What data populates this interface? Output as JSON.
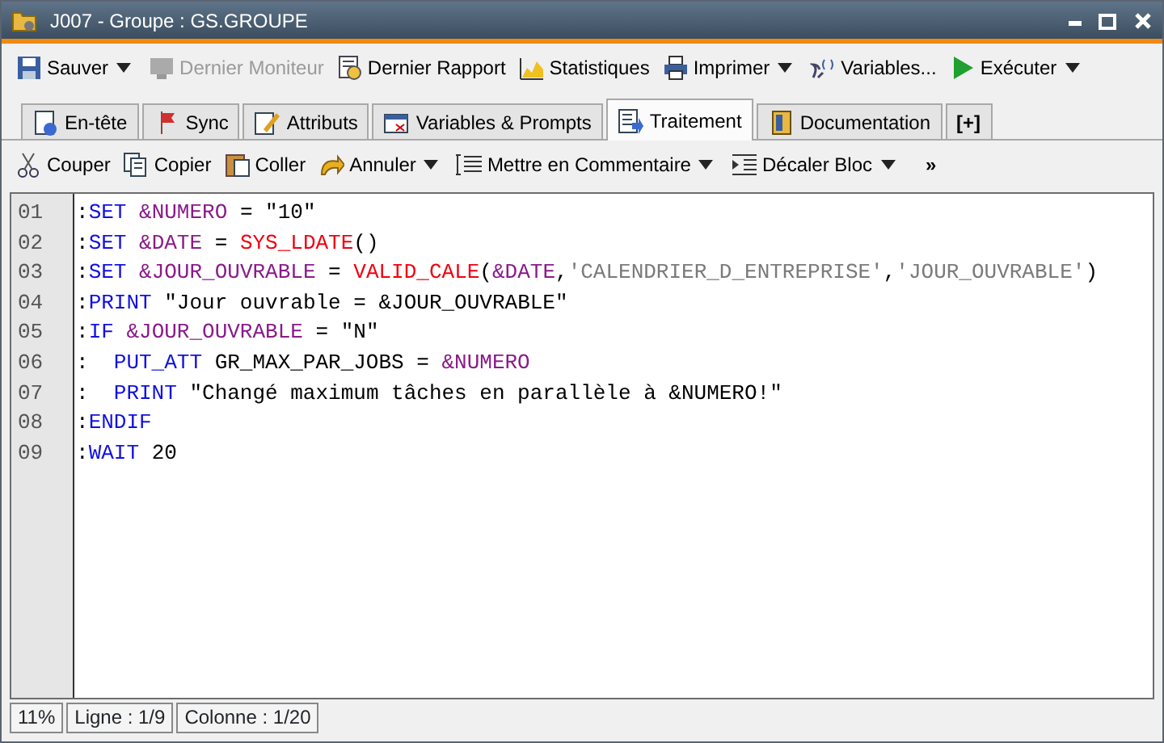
{
  "window": {
    "title": "J007 - Groupe : GS.GROUPE"
  },
  "toolbar": [
    {
      "label": "Sauver",
      "dropdown": true,
      "disabled": false
    },
    {
      "label": "Dernier Moniteur",
      "dropdown": false,
      "disabled": true
    },
    {
      "label": "Dernier Rapport",
      "dropdown": false,
      "disabled": false
    },
    {
      "label": "Statistiques",
      "dropdown": false,
      "disabled": false
    },
    {
      "label": "Imprimer",
      "dropdown": true,
      "disabled": false
    },
    {
      "label": "Variables...",
      "dropdown": false,
      "disabled": false
    },
    {
      "label": "Exécuter",
      "dropdown": true,
      "disabled": false
    }
  ],
  "tabs": [
    {
      "label": "En-tête",
      "selected": false
    },
    {
      "label": "Sync",
      "selected": false
    },
    {
      "label": "Attributs",
      "selected": false
    },
    {
      "label": "Variables & Prompts",
      "selected": false
    },
    {
      "label": "Traitement",
      "selected": true
    },
    {
      "label": "Documentation",
      "selected": false
    },
    {
      "label": "[+]",
      "selected": false
    }
  ],
  "edit_toolbar": [
    {
      "label": "Couper",
      "dropdown": false
    },
    {
      "label": "Copier",
      "dropdown": false
    },
    {
      "label": "Coller",
      "dropdown": false
    },
    {
      "label": "Annuler",
      "dropdown": true
    },
    {
      "label": "Mettre en Commentaire",
      "dropdown": true
    },
    {
      "label": "Décaler Bloc",
      "dropdown": true
    },
    {
      "label": "»",
      "dropdown": false
    }
  ],
  "editor": {
    "lines": [
      {
        "number": "01",
        "tokens": [
          {
            "kind": "text",
            "text": ":"
          },
          {
            "kind": "keyword",
            "text": "SET "
          },
          {
            "kind": "variable",
            "text": "&NUMERO"
          },
          {
            "kind": "text",
            "text": " = \"10\""
          }
        ]
      },
      {
        "number": "02",
        "tokens": [
          {
            "kind": "text",
            "text": ":"
          },
          {
            "kind": "keyword",
            "text": "SET "
          },
          {
            "kind": "variable",
            "text": "&DATE"
          },
          {
            "kind": "text",
            "text": " = "
          },
          {
            "kind": "function",
            "text": "SYS_LDATE"
          },
          {
            "kind": "text",
            "text": "()"
          }
        ]
      },
      {
        "number": "03",
        "tokens": [
          {
            "kind": "text",
            "text": ":"
          },
          {
            "kind": "keyword",
            "text": "SET "
          },
          {
            "kind": "variable",
            "text": "&JOUR_OUVRABLE"
          },
          {
            "kind": "text",
            "text": " = "
          },
          {
            "kind": "function",
            "text": "VALID_CALE"
          },
          {
            "kind": "text",
            "text": "("
          },
          {
            "kind": "variable",
            "text": "&DATE"
          },
          {
            "kind": "text",
            "text": ","
          },
          {
            "kind": "string",
            "text": "'CALENDRIER_D_ENTREPRISE'"
          },
          {
            "kind": "text",
            "text": ","
          },
          {
            "kind": "string",
            "text": "'JOUR_OUVRABLE'"
          },
          {
            "kind": "text",
            "text": ")"
          }
        ]
      },
      {
        "number": "04",
        "tokens": [
          {
            "kind": "text",
            "text": ":"
          },
          {
            "kind": "keyword",
            "text": "PRINT"
          },
          {
            "kind": "text",
            "text": " \"Jour ouvrable = &JOUR_OUVRABLE\""
          }
        ]
      },
      {
        "number": "05",
        "tokens": [
          {
            "kind": "text",
            "text": ":"
          },
          {
            "kind": "keyword",
            "text": "IF "
          },
          {
            "kind": "variable",
            "text": "&JOUR_OUVRABLE"
          },
          {
            "kind": "text",
            "text": " = \"N\""
          }
        ]
      },
      {
        "number": "06",
        "tokens": [
          {
            "kind": "text",
            "text": ":  "
          },
          {
            "kind": "keyword",
            "text": "PUT_ATT"
          },
          {
            "kind": "text",
            "text": " GR_MAX_PAR_JOBS = "
          },
          {
            "kind": "variable",
            "text": "&NUMERO"
          }
        ]
      },
      {
        "number": "07",
        "tokens": [
          {
            "kind": "text",
            "text": ":  "
          },
          {
            "kind": "keyword",
            "text": "PRINT"
          },
          {
            "kind": "text",
            "text": " \"Changé maximum tâches en parallèle à &NUMERO!\""
          }
        ]
      },
      {
        "number": "08",
        "tokens": [
          {
            "kind": "text",
            "text": ":"
          },
          {
            "kind": "keyword",
            "text": "ENDIF"
          }
        ]
      },
      {
        "number": "09",
        "tokens": [
          {
            "kind": "text",
            "text": ":"
          },
          {
            "kind": "keyword",
            "text": "WAIT"
          },
          {
            "kind": "text",
            "text": " 20"
          }
        ]
      }
    ]
  },
  "status_bar": [
    "11%",
    "Ligne : 1/9",
    "Colonne : 1/20"
  ]
}
